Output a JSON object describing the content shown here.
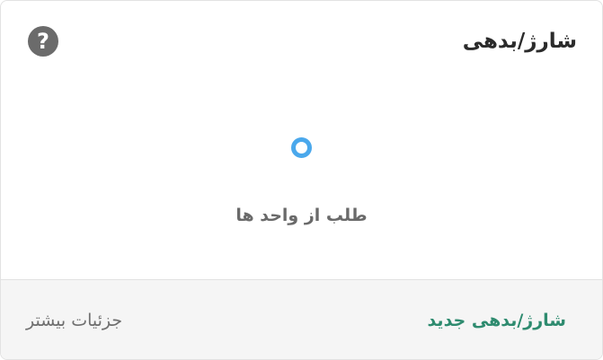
{
  "card": {
    "title": "شارژ/بدهی",
    "help_icon": "question-circle-icon",
    "help_symbol": "?",
    "status_icon": "status-dot-icon",
    "status_text": "طلب از واحد ها"
  },
  "footer": {
    "primary_action": "شارژ/بدهی جدید",
    "secondary_action": "جزئیات بیشتر"
  },
  "colors": {
    "accent": "#2e8b6f",
    "status_dot": "#4aa8ec",
    "help_icon_bg": "#6b6b6b",
    "footer_bg": "#f5f5f5"
  }
}
